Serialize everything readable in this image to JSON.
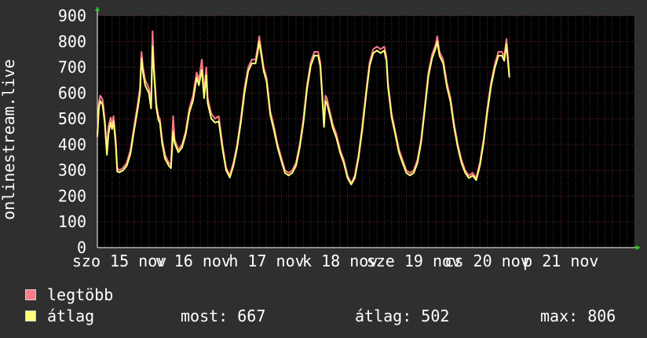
{
  "colors": {
    "background": "#2f2f2f",
    "plot_bg": "#000000",
    "grid_major": "#6b2a2a",
    "grid_minor": "#3a3a3a",
    "axis_arrow": "#22c922",
    "max_series": "#ff7b8b",
    "avg_series": "#ffff7a",
    "text": "#ffffff"
  },
  "legend": {
    "items": [
      {
        "label": "legtöbb",
        "color": "#ff7b8b"
      },
      {
        "label": "átlag",
        "color": "#ffff7a"
      }
    ]
  },
  "stats": {
    "most": "most: 667",
    "atlag": "átlag: 502",
    "max": "max: 806"
  },
  "chart_data": {
    "type": "line",
    "ylabel": "onlinestream.live",
    "ylim": [
      0,
      900
    ],
    "yticks": [
      0,
      100,
      200,
      300,
      400,
      500,
      600,
      700,
      800,
      900
    ],
    "grid": true,
    "xlim": [
      0,
      7.3
    ],
    "xticks": [
      {
        "x": 0.3,
        "label": "szo 15 nov"
      },
      {
        "x": 1.3,
        "label": "v 16 nov"
      },
      {
        "x": 2.3,
        "label": "h 17 nov"
      },
      {
        "x": 3.3,
        "label": "k 18 nov"
      },
      {
        "x": 4.3,
        "label": "sze 19 nov"
      },
      {
        "x": 5.3,
        "label": "cs 20 nov"
      },
      {
        "x": 6.3,
        "label": "p 21 nov"
      }
    ],
    "series": [
      {
        "name": "legtöbb",
        "points": [
          [
            0.0,
            440
          ],
          [
            0.02,
            560
          ],
          [
            0.04,
            590
          ],
          [
            0.07,
            575
          ],
          [
            0.1,
            500
          ],
          [
            0.13,
            380
          ],
          [
            0.15,
            470
          ],
          [
            0.18,
            505
          ],
          [
            0.2,
            480
          ],
          [
            0.22,
            510
          ],
          [
            0.25,
            420
          ],
          [
            0.27,
            310
          ],
          [
            0.3,
            300
          ],
          [
            0.35,
            310
          ],
          [
            0.4,
            330
          ],
          [
            0.45,
            380
          ],
          [
            0.5,
            470
          ],
          [
            0.55,
            560
          ],
          [
            0.58,
            620
          ],
          [
            0.6,
            760
          ],
          [
            0.62,
            700
          ],
          [
            0.65,
            650
          ],
          [
            0.7,
            620
          ],
          [
            0.73,
            560
          ],
          [
            0.75,
            840
          ],
          [
            0.77,
            700
          ],
          [
            0.8,
            560
          ],
          [
            0.83,
            510
          ],
          [
            0.85,
            500
          ],
          [
            0.88,
            420
          ],
          [
            0.92,
            360
          ],
          [
            0.97,
            330
          ],
          [
            1.0,
            320
          ],
          [
            1.03,
            510
          ],
          [
            1.05,
            420
          ],
          [
            1.1,
            380
          ],
          [
            1.15,
            400
          ],
          [
            1.2,
            450
          ],
          [
            1.25,
            540
          ],
          [
            1.3,
            590
          ],
          [
            1.35,
            680
          ],
          [
            1.38,
            650
          ],
          [
            1.42,
            730
          ],
          [
            1.45,
            600
          ],
          [
            1.48,
            700
          ],
          [
            1.5,
            580
          ],
          [
            1.55,
            520
          ],
          [
            1.6,
            500
          ],
          [
            1.65,
            510
          ],
          [
            1.7,
            400
          ],
          [
            1.75,
            310
          ],
          [
            1.8,
            280
          ],
          [
            1.85,
            330
          ],
          [
            1.9,
            400
          ],
          [
            1.95,
            500
          ],
          [
            2.0,
            620
          ],
          [
            2.05,
            700
          ],
          [
            2.1,
            730
          ],
          [
            2.15,
            730
          ],
          [
            2.18,
            780
          ],
          [
            2.2,
            820
          ],
          [
            2.23,
            760
          ],
          [
            2.26,
            700
          ],
          [
            2.3,
            660
          ],
          [
            2.35,
            530
          ],
          [
            2.4,
            470
          ],
          [
            2.45,
            400
          ],
          [
            2.5,
            350
          ],
          [
            2.55,
            300
          ],
          [
            2.6,
            290
          ],
          [
            2.65,
            300
          ],
          [
            2.7,
            330
          ],
          [
            2.75,
            400
          ],
          [
            2.8,
            500
          ],
          [
            2.85,
            630
          ],
          [
            2.9,
            720
          ],
          [
            2.95,
            760
          ],
          [
            3.0,
            760
          ],
          [
            3.03,
            720
          ],
          [
            3.05,
            630
          ],
          [
            3.08,
            480
          ],
          [
            3.1,
            590
          ],
          [
            3.12,
            580
          ],
          [
            3.15,
            540
          ],
          [
            3.2,
            480
          ],
          [
            3.25,
            440
          ],
          [
            3.3,
            380
          ],
          [
            3.35,
            340
          ],
          [
            3.4,
            280
          ],
          [
            3.45,
            250
          ],
          [
            3.5,
            280
          ],
          [
            3.55,
            360
          ],
          [
            3.6,
            470
          ],
          [
            3.65,
            600
          ],
          [
            3.7,
            720
          ],
          [
            3.75,
            770
          ],
          [
            3.8,
            780
          ],
          [
            3.85,
            770
          ],
          [
            3.9,
            780
          ],
          [
            3.93,
            740
          ],
          [
            3.95,
            640
          ],
          [
            4.0,
            520
          ],
          [
            4.05,
            450
          ],
          [
            4.1,
            380
          ],
          [
            4.15,
            340
          ],
          [
            4.2,
            300
          ],
          [
            4.25,
            290
          ],
          [
            4.3,
            300
          ],
          [
            4.35,
            340
          ],
          [
            4.4,
            420
          ],
          [
            4.45,
            550
          ],
          [
            4.5,
            680
          ],
          [
            4.55,
            750
          ],
          [
            4.6,
            790
          ],
          [
            4.62,
            820
          ],
          [
            4.65,
            760
          ],
          [
            4.7,
            730
          ],
          [
            4.75,
            640
          ],
          [
            4.8,
            580
          ],
          [
            4.85,
            480
          ],
          [
            4.9,
            400
          ],
          [
            4.95,
            340
          ],
          [
            5.0,
            300
          ],
          [
            5.05,
            280
          ],
          [
            5.1,
            290
          ],
          [
            5.15,
            270
          ],
          [
            5.2,
            330
          ],
          [
            5.25,
            420
          ],
          [
            5.3,
            540
          ],
          [
            5.35,
            640
          ],
          [
            5.4,
            710
          ],
          [
            5.45,
            760
          ],
          [
            5.5,
            760
          ],
          [
            5.53,
            740
          ],
          [
            5.56,
            810
          ],
          [
            5.6,
            670
          ]
        ]
      },
      {
        "name": "átlag",
        "points": [
          [
            0.0,
            430
          ],
          [
            0.02,
            540
          ],
          [
            0.04,
            570
          ],
          [
            0.07,
            555
          ],
          [
            0.1,
            485
          ],
          [
            0.13,
            360
          ],
          [
            0.15,
            440
          ],
          [
            0.18,
            485
          ],
          [
            0.2,
            460
          ],
          [
            0.22,
            490
          ],
          [
            0.25,
            400
          ],
          [
            0.27,
            295
          ],
          [
            0.3,
            292
          ],
          [
            0.35,
            300
          ],
          [
            0.4,
            318
          ],
          [
            0.45,
            365
          ],
          [
            0.5,
            455
          ],
          [
            0.55,
            540
          ],
          [
            0.58,
            600
          ],
          [
            0.6,
            735
          ],
          [
            0.62,
            680
          ],
          [
            0.65,
            630
          ],
          [
            0.7,
            600
          ],
          [
            0.73,
            540
          ],
          [
            0.75,
            780
          ],
          [
            0.77,
            680
          ],
          [
            0.8,
            545
          ],
          [
            0.83,
            495
          ],
          [
            0.85,
            485
          ],
          [
            0.88,
            405
          ],
          [
            0.92,
            345
          ],
          [
            0.97,
            318
          ],
          [
            1.0,
            308
          ],
          [
            1.03,
            450
          ],
          [
            1.05,
            405
          ],
          [
            1.1,
            370
          ],
          [
            1.15,
            388
          ],
          [
            1.2,
            438
          ],
          [
            1.25,
            525
          ],
          [
            1.3,
            570
          ],
          [
            1.35,
            660
          ],
          [
            1.38,
            630
          ],
          [
            1.42,
            690
          ],
          [
            1.45,
            580
          ],
          [
            1.48,
            670
          ],
          [
            1.5,
            560
          ],
          [
            1.55,
            500
          ],
          [
            1.6,
            485
          ],
          [
            1.65,
            490
          ],
          [
            1.7,
            385
          ],
          [
            1.75,
            300
          ],
          [
            1.8,
            272
          ],
          [
            1.85,
            318
          ],
          [
            1.9,
            388
          ],
          [
            1.95,
            485
          ],
          [
            2.0,
            600
          ],
          [
            2.05,
            685
          ],
          [
            2.1,
            715
          ],
          [
            2.15,
            715
          ],
          [
            2.18,
            760
          ],
          [
            2.2,
            800
          ],
          [
            2.23,
            745
          ],
          [
            2.26,
            685
          ],
          [
            2.3,
            645
          ],
          [
            2.35,
            515
          ],
          [
            2.4,
            455
          ],
          [
            2.45,
            388
          ],
          [
            2.5,
            338
          ],
          [
            2.55,
            290
          ],
          [
            2.6,
            280
          ],
          [
            2.65,
            290
          ],
          [
            2.7,
            318
          ],
          [
            2.75,
            388
          ],
          [
            2.8,
            485
          ],
          [
            2.85,
            615
          ],
          [
            2.9,
            705
          ],
          [
            2.95,
            745
          ],
          [
            3.0,
            745
          ],
          [
            3.03,
            705
          ],
          [
            3.05,
            615
          ],
          [
            3.08,
            468
          ],
          [
            3.1,
            570
          ],
          [
            3.12,
            560
          ],
          [
            3.15,
            525
          ],
          [
            3.2,
            465
          ],
          [
            3.25,
            425
          ],
          [
            3.3,
            368
          ],
          [
            3.35,
            328
          ],
          [
            3.4,
            270
          ],
          [
            3.45,
            245
          ],
          [
            3.5,
            270
          ],
          [
            3.55,
            348
          ],
          [
            3.6,
            455
          ],
          [
            3.65,
            585
          ],
          [
            3.7,
            705
          ],
          [
            3.75,
            755
          ],
          [
            3.8,
            765
          ],
          [
            3.85,
            755
          ],
          [
            3.9,
            765
          ],
          [
            3.93,
            725
          ],
          [
            3.95,
            625
          ],
          [
            4.0,
            505
          ],
          [
            4.05,
            438
          ],
          [
            4.1,
            368
          ],
          [
            4.15,
            328
          ],
          [
            4.2,
            290
          ],
          [
            4.25,
            280
          ],
          [
            4.3,
            290
          ],
          [
            4.35,
            328
          ],
          [
            4.4,
            408
          ],
          [
            4.45,
            535
          ],
          [
            4.5,
            665
          ],
          [
            4.55,
            735
          ],
          [
            4.6,
            775
          ],
          [
            4.62,
            800
          ],
          [
            4.65,
            745
          ],
          [
            4.7,
            715
          ],
          [
            4.75,
            625
          ],
          [
            4.8,
            565
          ],
          [
            4.85,
            465
          ],
          [
            4.9,
            388
          ],
          [
            4.95,
            328
          ],
          [
            5.0,
            290
          ],
          [
            5.05,
            270
          ],
          [
            5.1,
            280
          ],
          [
            5.15,
            262
          ],
          [
            5.2,
            318
          ],
          [
            5.25,
            408
          ],
          [
            5.3,
            525
          ],
          [
            5.35,
            625
          ],
          [
            5.4,
            695
          ],
          [
            5.45,
            745
          ],
          [
            5.5,
            745
          ],
          [
            5.53,
            725
          ],
          [
            5.56,
            790
          ],
          [
            5.6,
            660
          ]
        ]
      }
    ]
  }
}
